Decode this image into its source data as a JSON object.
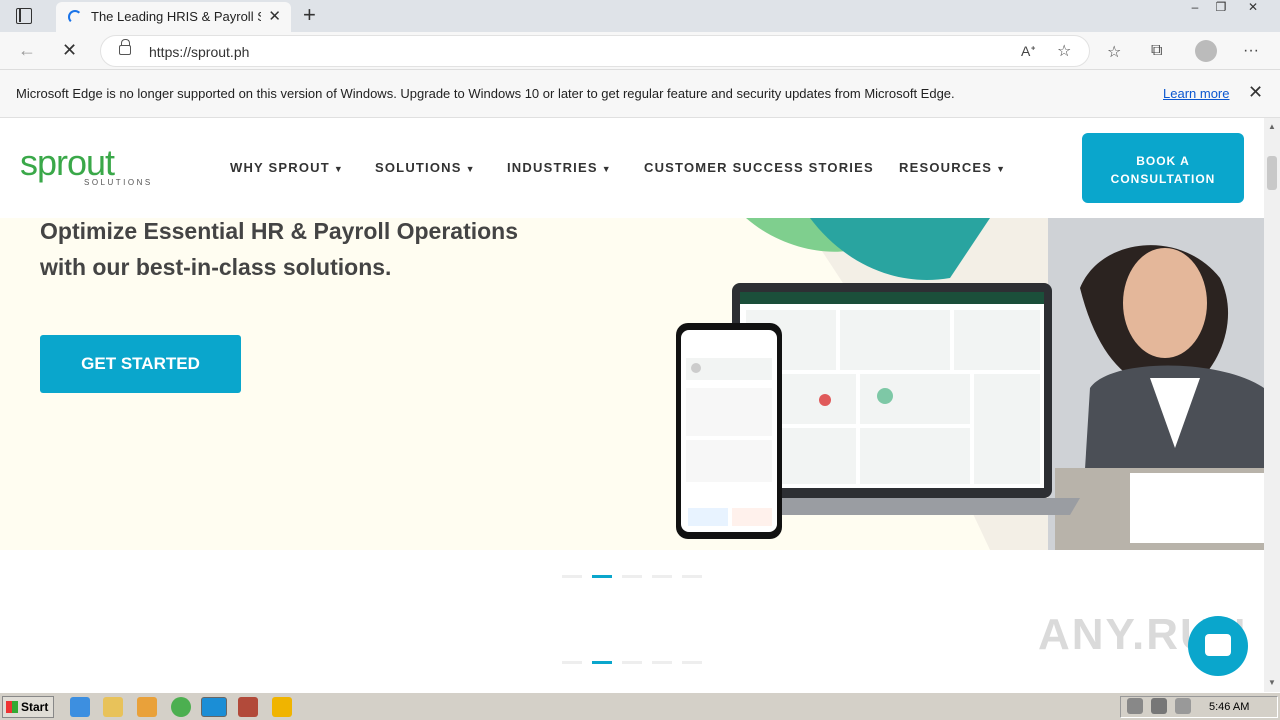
{
  "browser": {
    "tab_title": "The Leading HRIS & Payroll Sof",
    "new_tab_symbol": "+",
    "url": "https://sprout.ph",
    "window_controls": [
      "–",
      "❐",
      "✕"
    ]
  },
  "infobar": {
    "message": "Microsoft Edge is no longer supported on this version of Windows. Upgrade to Windows 10 or later to get regular feature and security updates from Microsoft Edge.",
    "learn_more": "Learn more"
  },
  "site": {
    "logo_word": "sprout",
    "logo_sub": "SOLUTIONS",
    "nav": [
      {
        "label": "WHY SPROUT",
        "has_caret": true
      },
      {
        "label": "SOLUTIONS",
        "has_caret": true
      },
      {
        "label": "INDUSTRIES",
        "has_caret": true
      },
      {
        "label": "CUSTOMER SUCCESS STORIES",
        "has_caret": false
      },
      {
        "label": "RESOURCES",
        "has_caret": true
      }
    ],
    "cta_book_line1": "BOOK A",
    "cta_book_line2": "CONSULTATION",
    "hero_title_line1": "Optimize Essential HR & Payroll Operations",
    "hero_title_line2": "with our best-in-class solutions.",
    "get_started": "GET STARTED",
    "carousel_active_index": 1,
    "carousel_count": 5,
    "brand_color": "#0aa6cc",
    "logo_color": "#3aa849"
  },
  "taskbar": {
    "start_label": "Start",
    "time": "5:46 AM"
  },
  "watermark": "ANY.RUN"
}
